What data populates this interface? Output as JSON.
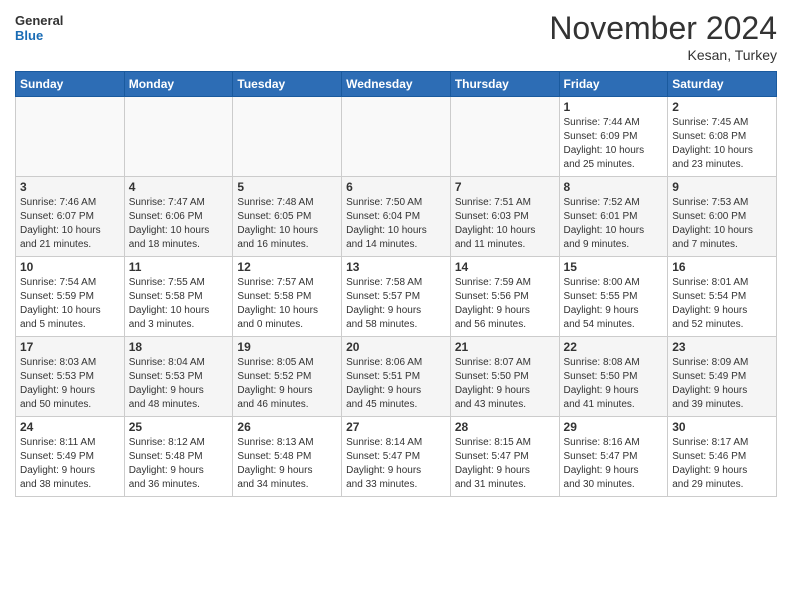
{
  "header": {
    "logo_line1": "General",
    "logo_line2": "Blue",
    "month": "November 2024",
    "location": "Kesan, Turkey"
  },
  "weekdays": [
    "Sunday",
    "Monday",
    "Tuesday",
    "Wednesday",
    "Thursday",
    "Friday",
    "Saturday"
  ],
  "weeks": [
    [
      {
        "day": "",
        "info": ""
      },
      {
        "day": "",
        "info": ""
      },
      {
        "day": "",
        "info": ""
      },
      {
        "day": "",
        "info": ""
      },
      {
        "day": "",
        "info": ""
      },
      {
        "day": "1",
        "info": "Sunrise: 7:44 AM\nSunset: 6:09 PM\nDaylight: 10 hours\nand 25 minutes."
      },
      {
        "day": "2",
        "info": "Sunrise: 7:45 AM\nSunset: 6:08 PM\nDaylight: 10 hours\nand 23 minutes."
      }
    ],
    [
      {
        "day": "3",
        "info": "Sunrise: 7:46 AM\nSunset: 6:07 PM\nDaylight: 10 hours\nand 21 minutes."
      },
      {
        "day": "4",
        "info": "Sunrise: 7:47 AM\nSunset: 6:06 PM\nDaylight: 10 hours\nand 18 minutes."
      },
      {
        "day": "5",
        "info": "Sunrise: 7:48 AM\nSunset: 6:05 PM\nDaylight: 10 hours\nand 16 minutes."
      },
      {
        "day": "6",
        "info": "Sunrise: 7:50 AM\nSunset: 6:04 PM\nDaylight: 10 hours\nand 14 minutes."
      },
      {
        "day": "7",
        "info": "Sunrise: 7:51 AM\nSunset: 6:03 PM\nDaylight: 10 hours\nand 11 minutes."
      },
      {
        "day": "8",
        "info": "Sunrise: 7:52 AM\nSunset: 6:01 PM\nDaylight: 10 hours\nand 9 minutes."
      },
      {
        "day": "9",
        "info": "Sunrise: 7:53 AM\nSunset: 6:00 PM\nDaylight: 10 hours\nand 7 minutes."
      }
    ],
    [
      {
        "day": "10",
        "info": "Sunrise: 7:54 AM\nSunset: 5:59 PM\nDaylight: 10 hours\nand 5 minutes."
      },
      {
        "day": "11",
        "info": "Sunrise: 7:55 AM\nSunset: 5:58 PM\nDaylight: 10 hours\nand 3 minutes."
      },
      {
        "day": "12",
        "info": "Sunrise: 7:57 AM\nSunset: 5:58 PM\nDaylight: 10 hours\nand 0 minutes."
      },
      {
        "day": "13",
        "info": "Sunrise: 7:58 AM\nSunset: 5:57 PM\nDaylight: 9 hours\nand 58 minutes."
      },
      {
        "day": "14",
        "info": "Sunrise: 7:59 AM\nSunset: 5:56 PM\nDaylight: 9 hours\nand 56 minutes."
      },
      {
        "day": "15",
        "info": "Sunrise: 8:00 AM\nSunset: 5:55 PM\nDaylight: 9 hours\nand 54 minutes."
      },
      {
        "day": "16",
        "info": "Sunrise: 8:01 AM\nSunset: 5:54 PM\nDaylight: 9 hours\nand 52 minutes."
      }
    ],
    [
      {
        "day": "17",
        "info": "Sunrise: 8:03 AM\nSunset: 5:53 PM\nDaylight: 9 hours\nand 50 minutes."
      },
      {
        "day": "18",
        "info": "Sunrise: 8:04 AM\nSunset: 5:53 PM\nDaylight: 9 hours\nand 48 minutes."
      },
      {
        "day": "19",
        "info": "Sunrise: 8:05 AM\nSunset: 5:52 PM\nDaylight: 9 hours\nand 46 minutes."
      },
      {
        "day": "20",
        "info": "Sunrise: 8:06 AM\nSunset: 5:51 PM\nDaylight: 9 hours\nand 45 minutes."
      },
      {
        "day": "21",
        "info": "Sunrise: 8:07 AM\nSunset: 5:50 PM\nDaylight: 9 hours\nand 43 minutes."
      },
      {
        "day": "22",
        "info": "Sunrise: 8:08 AM\nSunset: 5:50 PM\nDaylight: 9 hours\nand 41 minutes."
      },
      {
        "day": "23",
        "info": "Sunrise: 8:09 AM\nSunset: 5:49 PM\nDaylight: 9 hours\nand 39 minutes."
      }
    ],
    [
      {
        "day": "24",
        "info": "Sunrise: 8:11 AM\nSunset: 5:49 PM\nDaylight: 9 hours\nand 38 minutes."
      },
      {
        "day": "25",
        "info": "Sunrise: 8:12 AM\nSunset: 5:48 PM\nDaylight: 9 hours\nand 36 minutes."
      },
      {
        "day": "26",
        "info": "Sunrise: 8:13 AM\nSunset: 5:48 PM\nDaylight: 9 hours\nand 34 minutes."
      },
      {
        "day": "27",
        "info": "Sunrise: 8:14 AM\nSunset: 5:47 PM\nDaylight: 9 hours\nand 33 minutes."
      },
      {
        "day": "28",
        "info": "Sunrise: 8:15 AM\nSunset: 5:47 PM\nDaylight: 9 hours\nand 31 minutes."
      },
      {
        "day": "29",
        "info": "Sunrise: 8:16 AM\nSunset: 5:47 PM\nDaylight: 9 hours\nand 30 minutes."
      },
      {
        "day": "30",
        "info": "Sunrise: 8:17 AM\nSunset: 5:46 PM\nDaylight: 9 hours\nand 29 minutes."
      }
    ]
  ]
}
